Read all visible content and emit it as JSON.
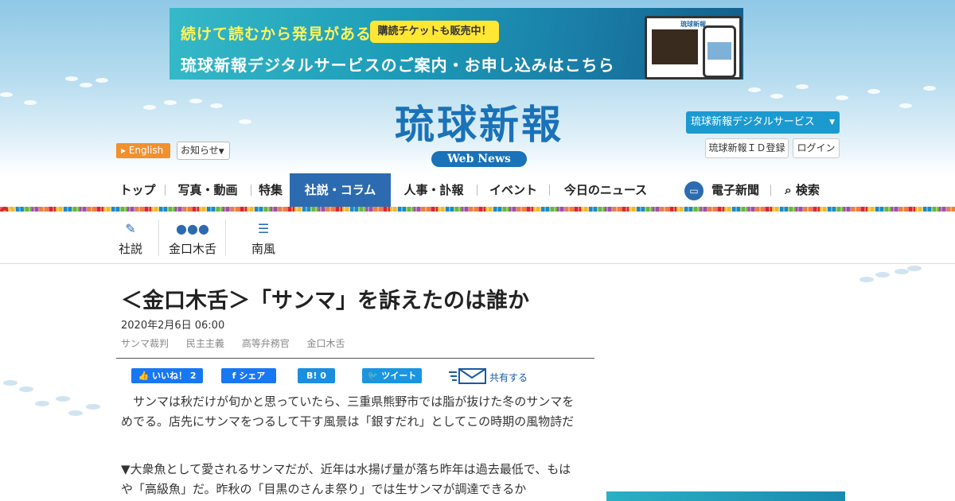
{
  "banner": {
    "line1": "続けて読むから発見がある",
    "pill": "購読チケットも販売中！",
    "line2": "琉球新報デジタルサービスのご案内・お申し込みはこちら",
    "mock_title": "琉球新報"
  },
  "logo": {
    "name": "琉球新報",
    "sub": "Web News"
  },
  "header": {
    "english": "English",
    "notice": "お知らせ",
    "digital": "琉球新報デジタルサービス",
    "id_register": "琉球新報ＩＤ登録",
    "login": "ログイン"
  },
  "nav": {
    "items": [
      "トップ",
      "写真・動画",
      "特集",
      "社説・コラム",
      "人事・訃報",
      "イベント",
      "今日のニュース",
      "電子新聞",
      "検索"
    ],
    "active": "社説・コラム"
  },
  "subnav": {
    "items": [
      "社説",
      "金口木舌",
      "南風"
    ]
  },
  "article": {
    "title": "＜金口木舌＞「サンマ」を訴えたのは誰か",
    "date": "2020年2月6日 06:00",
    "tags": [
      "サンマ裁判",
      "民主主義",
      "高等弁務官",
      "金口木舌"
    ],
    "share": {
      "like": "いいね！ 2",
      "fb_share": "シェア",
      "hatena": "B! 0",
      "tweet": "ツイート",
      "share_label": "共有する"
    },
    "paragraphs": [
      "　サンマは秋だけが旬かと思っていたら、三重県熊野市では脂が抜けた冬のサンマをめでる。店先にサンマをつるして干す風景は「銀すだれ」としてこの時期の風物詩だ",
      "▼大衆魚として愛されるサンマだが、近年は水揚げ量が落ち昨年は過去最低で、もはや「高級魚」だ。昨秋の「目黒のさんま祭り」では生サンマが調達できるか"
    ]
  },
  "colors": {
    "brand": "#1a72b8",
    "nav_active": "#2c6bb0",
    "english": "#f0902e",
    "digital": "#1b9ad0"
  }
}
